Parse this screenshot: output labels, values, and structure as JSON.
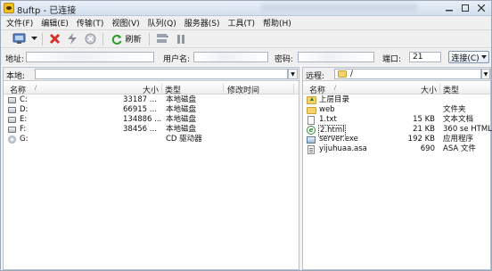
{
  "window": {
    "title": "8uftp - 已连接"
  },
  "menu": [
    "文件(F)",
    "编辑(E)",
    "传输(T)",
    "视图(V)",
    "队列(Q)",
    "服务器(S)",
    "工具(T)",
    "帮助(H)"
  ],
  "toolbar": {
    "refresh_label": "刷新"
  },
  "address": {
    "host_label": "地址:",
    "user_label": "用户名:",
    "password_label": "密码:",
    "port_label": "端口:",
    "port_value": "21",
    "connect_label": "连接(C)"
  },
  "local": {
    "path_label": "本地:",
    "columns": {
      "name": "名称",
      "size": "大小",
      "type": "类型",
      "modified": "修改时间"
    },
    "rows": [
      {
        "name": "C:",
        "size": "33187 ...",
        "type": "本地磁盘",
        "icon": "drive-icon"
      },
      {
        "name": "D:",
        "size": "66915 ...",
        "type": "本地磁盘",
        "icon": "drive-icon"
      },
      {
        "name": "E:",
        "size": "134886 ...",
        "type": "本地磁盘",
        "icon": "drive-icon"
      },
      {
        "name": "F:",
        "size": "38456 ...",
        "type": "本地磁盘",
        "icon": "drive-icon"
      },
      {
        "name": "G:",
        "size": "",
        "type": "CD 驱动器",
        "icon": "cd-drive-icon"
      }
    ]
  },
  "remote": {
    "path_label": "远程:",
    "path_value": "/",
    "columns": {
      "name": "名称",
      "size": "大小",
      "type": "类型"
    },
    "rows": [
      {
        "name": "上层目录",
        "size": "",
        "type": "",
        "icon": "up-folder-icon"
      },
      {
        "name": "web",
        "size": "",
        "type": "文件夹",
        "icon": "folder-icon"
      },
      {
        "name": "1.txt",
        "size": "15 KB",
        "type": "文本文档",
        "icon": "file-icon"
      },
      {
        "name": "2.html",
        "size": "21 KB",
        "type": "360 se HTML...",
        "icon": "html-icon",
        "selected": true
      },
      {
        "name": "server.exe",
        "size": "192 KB",
        "type": "应用程序",
        "icon": "exe-icon"
      },
      {
        "name": "yijuhuaa.asa",
        "size": "690",
        "type": "ASA 文件",
        "icon": "asa-icon"
      }
    ]
  }
}
